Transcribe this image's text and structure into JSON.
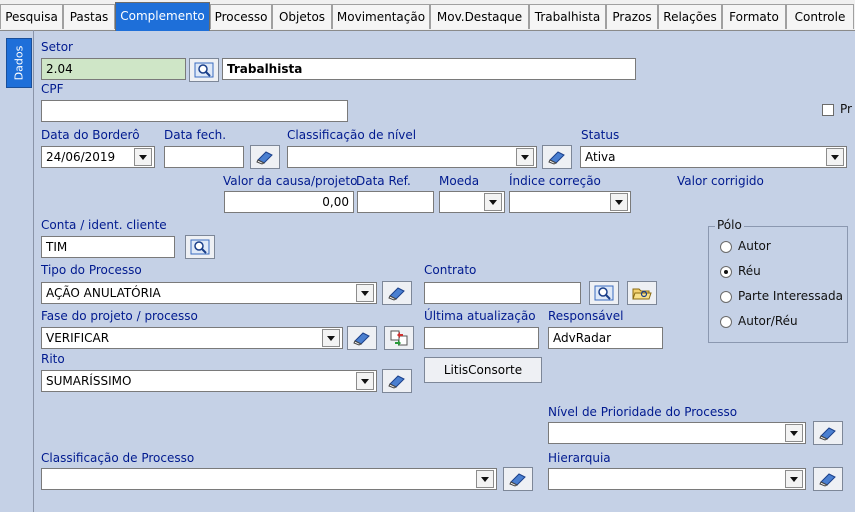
{
  "tabs": [
    "Pesquisa",
    "Pastas",
    "Complemento",
    "Processo",
    "Objetos",
    "Movimentação",
    "Mov.Destaque",
    "Trabalhista",
    "Prazos",
    "Relações",
    "Formato",
    "Controle"
  ],
  "active_tab": "Complemento",
  "side_tab": "Dados",
  "labels": {
    "setor": "Setor",
    "cpf": "CPF",
    "data_bordero": "Data do Borderô",
    "data_fech": "Data fech.",
    "classificacao_nivel": "Classificação de nível",
    "status": "Status",
    "valor_causa": "Valor da causa/projeto",
    "data_ref": "Data Ref.",
    "moeda": "Moeda",
    "indice_correcao": "Índice correção",
    "valor_corrigido": "Valor corrigido",
    "conta": "Conta / ident. cliente",
    "tipo_processo": "Tipo do Processo",
    "contrato": "Contrato",
    "fase": "Fase do projeto / processo",
    "ultima_atualizacao": "Última atualização",
    "responsavel": "Responsável",
    "rito": "Rito",
    "nivel_prioridade": "Nível de Prioridade do Processo",
    "classificacao_processo": "Classificação de Processo",
    "hierarquia": "Hierarquia",
    "checkbox_pr": "Pr"
  },
  "values": {
    "setor_code": "2.04",
    "setor_name": "Trabalhista",
    "cpf": "",
    "data_bordero": "24/06/2019",
    "data_fech": "",
    "classificacao_nivel": "",
    "status": "Ativa",
    "valor_causa": "0,00",
    "data_ref": "",
    "moeda": "",
    "indice_correcao": "",
    "conta": "TIM",
    "tipo_processo": "AÇÃO ANULATÓRIA",
    "contrato": "",
    "fase": "VERIFICAR",
    "ultima_atualizacao": "",
    "responsavel": "AdvRadar",
    "rito": "SUMARÍSSIMO",
    "nivel_prioridade": "",
    "classificacao_processo": "",
    "hierarquia": ""
  },
  "polo": {
    "title": "Pólo",
    "options": [
      "Autor",
      "Réu",
      "Parte Interessada",
      "Autor/Réu"
    ],
    "selected": "Réu"
  },
  "buttons": {
    "litis": "LitisConsorte"
  },
  "icons": {
    "search": "magnifier-icon",
    "eraser": "eraser-icon",
    "folder": "folder-open-icon",
    "transfer": "transfer-icon",
    "dropdown": "chevron-down-icon"
  }
}
